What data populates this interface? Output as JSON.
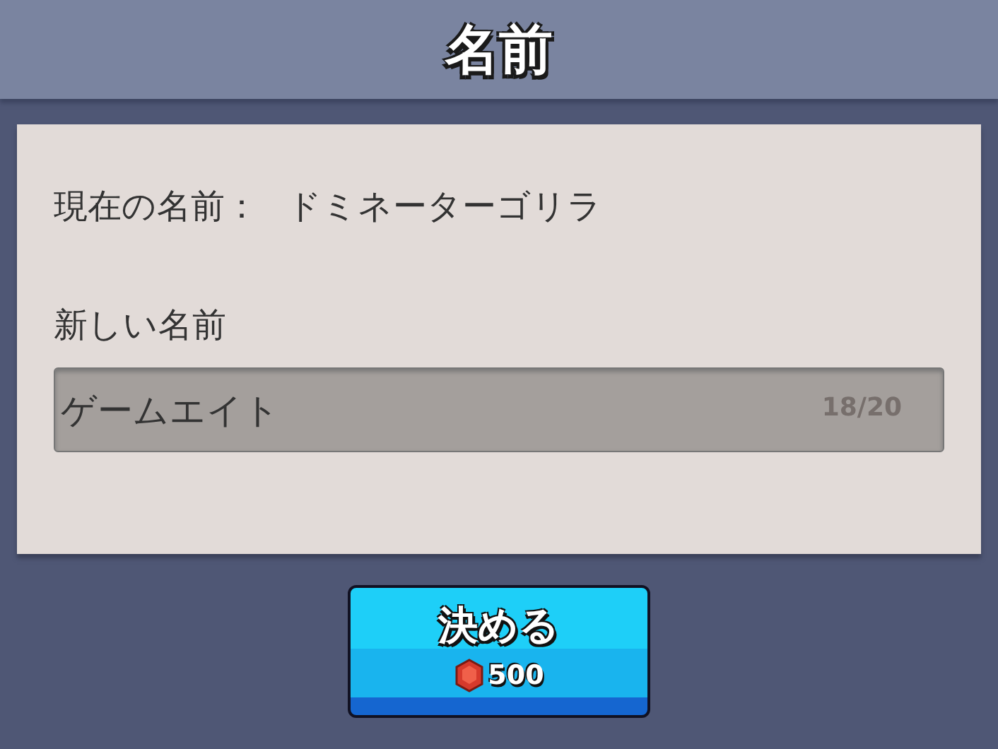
{
  "header": {
    "title": "名前"
  },
  "current_name": {
    "label": "現在の名前：",
    "value": "ドミネーターゴリラ"
  },
  "new_name": {
    "label": "新しい名前",
    "value": "ゲームエイト",
    "counter": "18/20"
  },
  "confirm_button": {
    "label": "決める",
    "price": "500"
  }
}
